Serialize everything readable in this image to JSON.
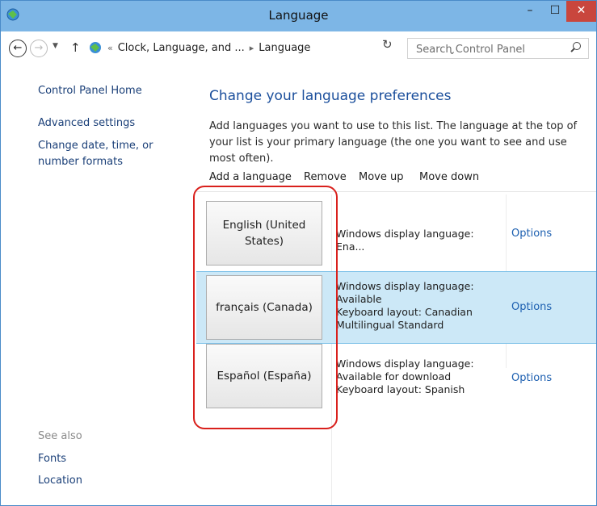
{
  "window": {
    "title": "Language",
    "controls": {
      "minimize": "–",
      "maximize": "☐",
      "close": "✕"
    }
  },
  "address": {
    "breadcrumb_prefix": "«",
    "crumbs": [
      "Clock, Language, and ...",
      "Language"
    ],
    "separator": "▸",
    "dropdown": "⌄",
    "refresh": "↻",
    "search_placeholder": "Search Control Panel"
  },
  "sidebar": {
    "links": [
      "Control Panel Home",
      "Advanced settings",
      "Change date, time, or number formats"
    ],
    "see_also_label": "See also",
    "see_also_links": [
      "Fonts",
      "Location"
    ]
  },
  "main": {
    "heading": "Change your language preferences",
    "description": "Add languages you want to use to this list. The language at the top of your list is your primary language (the one you want to see and use most often).",
    "toolbar": [
      "Add a language",
      "Remove",
      "Move up",
      "Move down"
    ],
    "languages": [
      {
        "name": "English (United States)",
        "info": [
          "Windows display language: Ena..."
        ],
        "options": "Options",
        "selected": false
      },
      {
        "name": "français (Canada)",
        "info": [
          "Windows display language:",
          "Available",
          "Keyboard layout: Canadian",
          "Multilingual Standard"
        ],
        "options": "Options",
        "selected": true
      },
      {
        "name": "Español (España)",
        "info": [
          "Windows display language:",
          "Available for download",
          "Keyboard layout: Spanish"
        ],
        "options": "Options",
        "selected": false
      }
    ]
  },
  "colors": {
    "titlebar": "#7db6e6",
    "close_button": "#c9463d",
    "selected_row": "#cce8f7",
    "link": "#1a3f78",
    "heading": "#1b4f9c",
    "callout": "#d9201c"
  }
}
